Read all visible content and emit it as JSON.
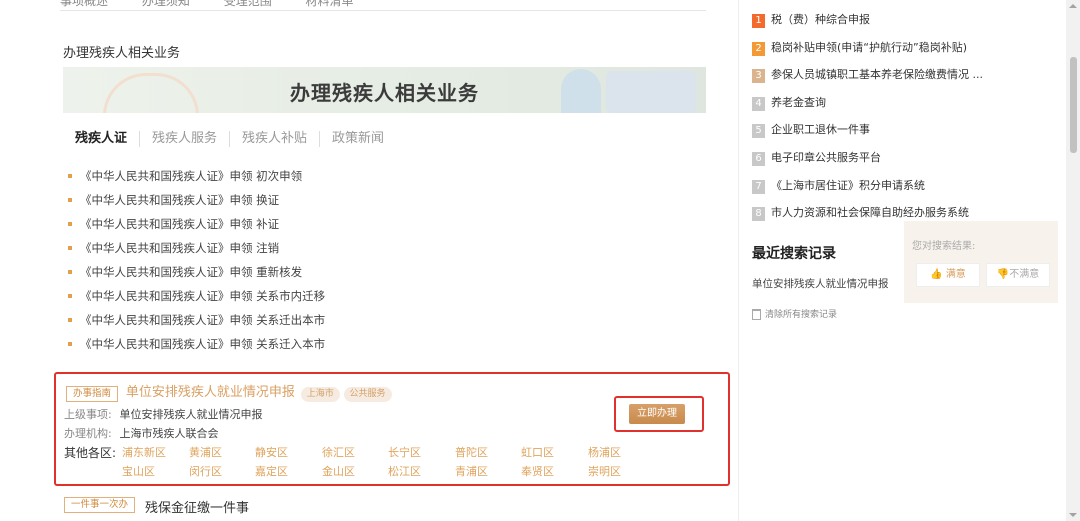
{
  "top_nav": [
    "事项概述",
    "办理须知",
    "受理范围",
    "材料清单"
  ],
  "section_title": "办理残疾人相关业务",
  "banner_text": "办理残疾人相关业务",
  "tabs": [
    "残疾人证",
    "残疾人服务",
    "残疾人补贴",
    "政策新闻"
  ],
  "services": [
    "《中华人民共和国残疾人证》申领 初次申领",
    "《中华人民共和国残疾人证》申领 换证",
    "《中华人民共和国残疾人证》申领 补证",
    "《中华人民共和国残疾人证》申领 注销",
    "《中华人民共和国残疾人证》申领 重新核发",
    "《中华人民共和国残疾人证》申领 关系市内迁移",
    "《中华人民共和国残疾人证》申领 关系迁出本市",
    "《中华人民共和国残疾人证》申领 关系迁入本市"
  ],
  "guide": {
    "tag": "办事指南",
    "title": "单位安排残疾人就业情况申报",
    "pills": [
      "上海市",
      "公共服务"
    ],
    "parent_label": "上级事项:",
    "parent_value": "单位安排残疾人就业情况申报",
    "org_label": "办理机构:",
    "org_value": "上海市残疾人联合会",
    "districts_label": "其他各区:",
    "districts_row1": [
      "浦东新区",
      "黄浦区",
      "静安区",
      "徐汇区",
      "长宁区",
      "普陀区",
      "虹口区",
      "杨浦区"
    ],
    "districts_row2": [
      "宝山区",
      "闵行区",
      "嘉定区",
      "金山区",
      "松江区",
      "青浦区",
      "奉贤区",
      "崇明区"
    ],
    "apply_label": "立即办理"
  },
  "next_item": {
    "tag": "一件事一次办",
    "title": "残保金征缴一件事"
  },
  "hot_list": [
    "税（费）种综合申报",
    "稳岗补贴申领(申请“护航行动”稳岗补贴)",
    "参保人员城镇职工基本养老保险缴费情况 ...",
    "养老金查询",
    "企业职工退休一件事",
    "电子印章公共服务平台",
    "《上海市居住证》积分申请系统",
    "市人力资源和社会保障自助经办服务系统"
  ],
  "recent": {
    "title": "最近搜索记录",
    "item": "单位安排残疾人就业情况申报",
    "clear_label": "清除所有搜索记录"
  },
  "feedback": {
    "label": "您对搜索结果:",
    "good": "满意",
    "bad": "不满意"
  },
  "colors": {
    "accent": "#d9a063",
    "highlight_border": "#e0312d",
    "rank1": "#f26a2c",
    "rank2": "#f39a36"
  }
}
